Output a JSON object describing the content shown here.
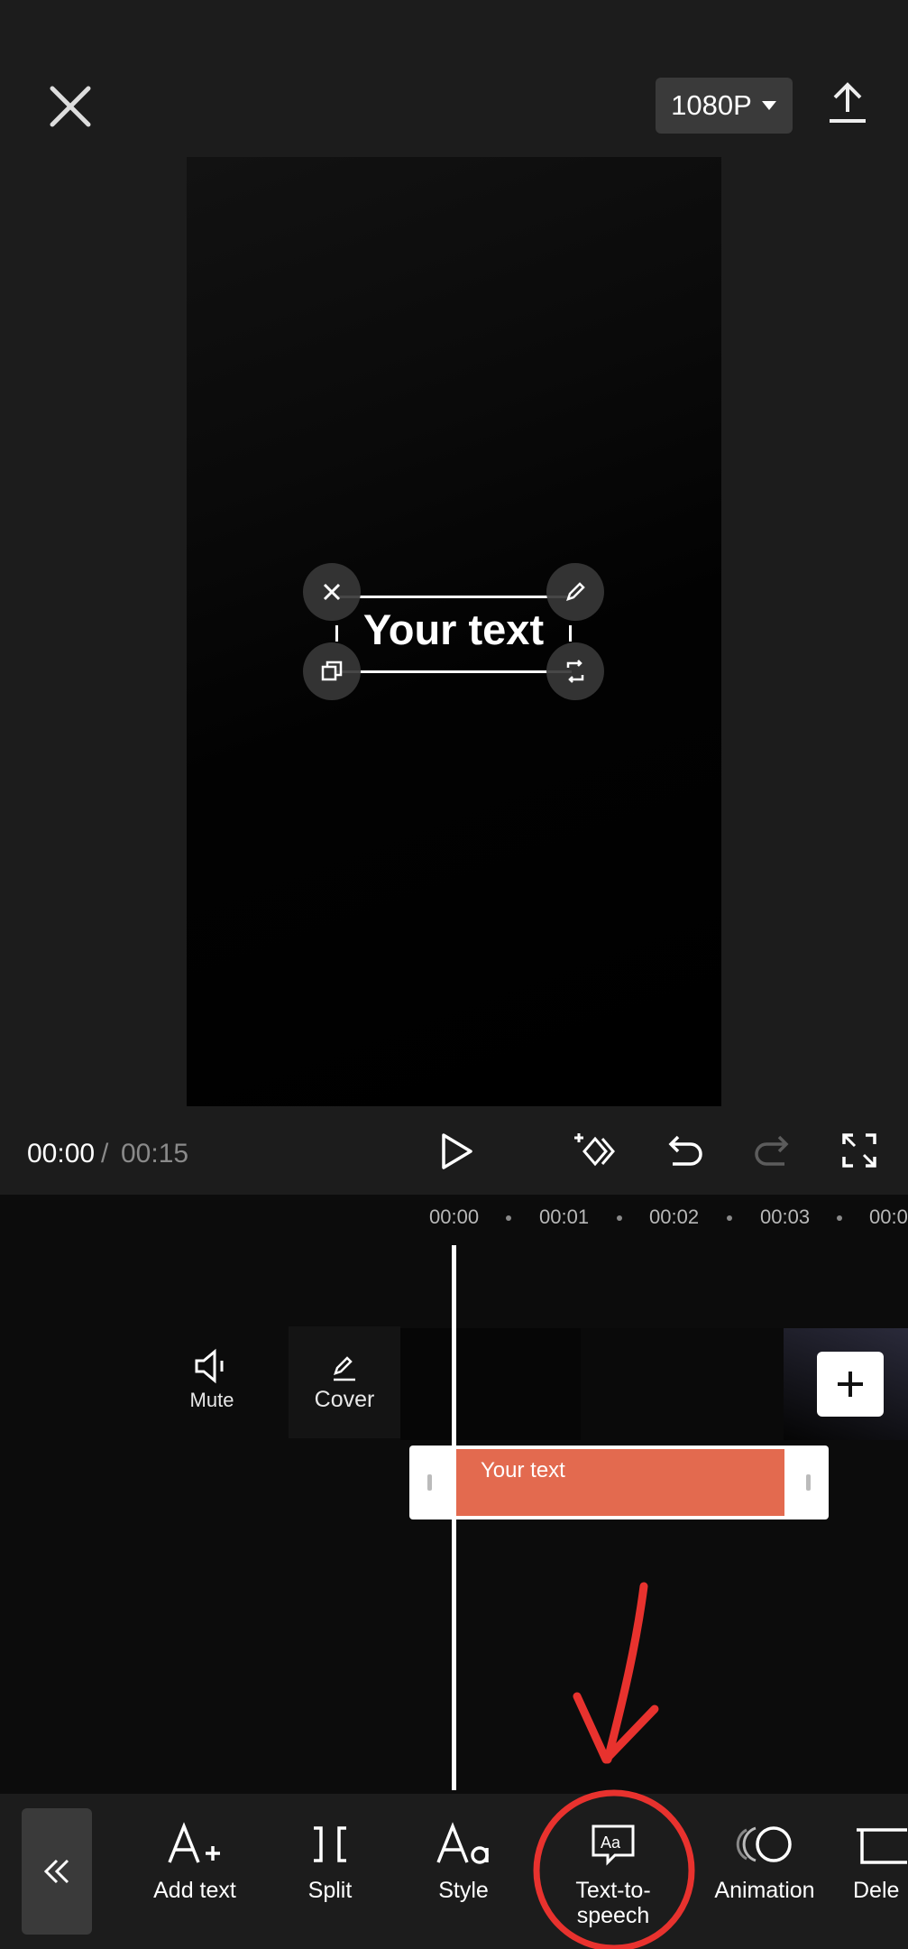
{
  "top_bar": {
    "resolution_label": "1080P",
    "close_icon": "close-icon",
    "export_icon": "upload-icon"
  },
  "preview": {
    "overlay_text": "Your text"
  },
  "playback": {
    "current_time": "00:00",
    "separator": "/",
    "total_time": "00:15"
  },
  "timeline": {
    "ticks": [
      "00:00",
      "00:01",
      "00:02",
      "00:03",
      "00:0"
    ],
    "mute_label": "Mute",
    "cover_label": "Cover",
    "text_clip_label": "Your text"
  },
  "toolbar": {
    "items": [
      {
        "label": "Add text",
        "icon": "add-text-icon"
      },
      {
        "label": "Split",
        "icon": "split-icon"
      },
      {
        "label": "Style",
        "icon": "style-icon"
      },
      {
        "label": "Text-to-\nspeech",
        "icon": "text-to-speech-icon"
      },
      {
        "label": "Animation",
        "icon": "animation-icon"
      },
      {
        "label": "Dele",
        "icon": "delete-icon"
      }
    ]
  },
  "colors": {
    "background": "#1c1c1c",
    "text_clip": "#e36a4f",
    "annotation": "#e8322e"
  }
}
